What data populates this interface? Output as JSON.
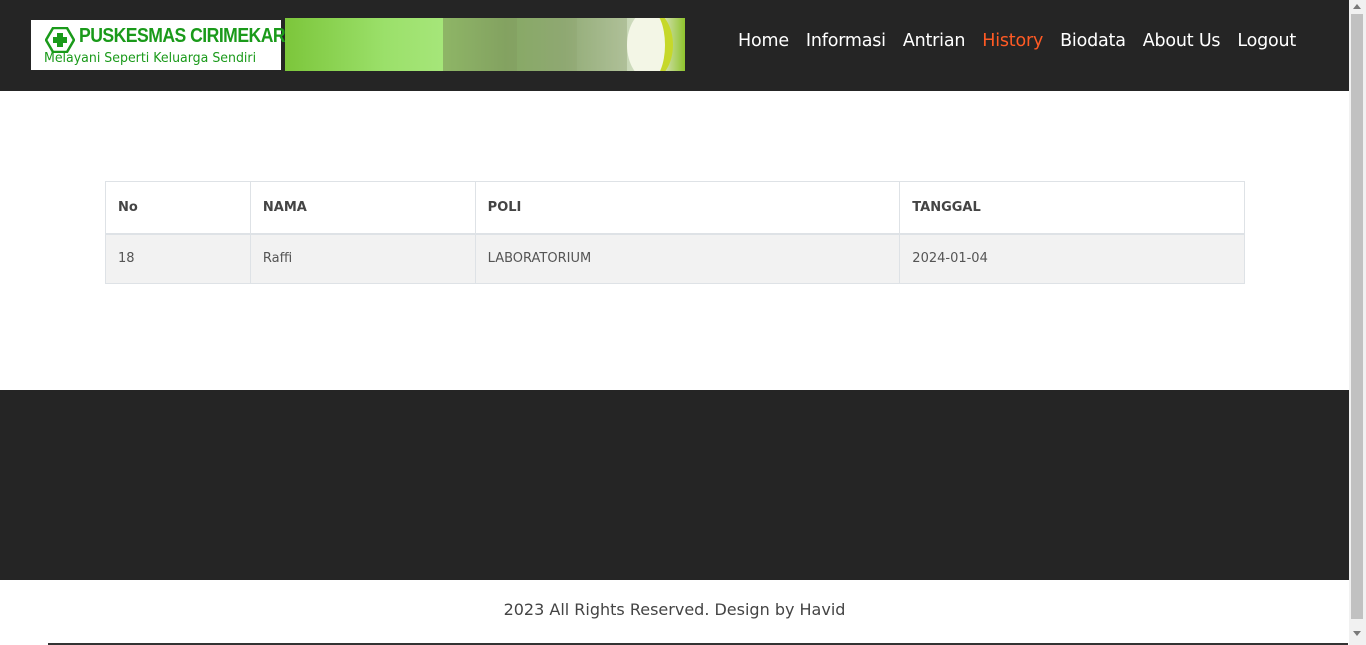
{
  "header": {
    "logo_title": "PUSKESMAS CIRIMEKAR",
    "logo_tagline": "Melayani Seperti Keluarga Sendiri",
    "logo_icon": "medical-cross-icon",
    "brand_color": "#1a9a1a",
    "nav": [
      {
        "label": "Home",
        "active": false
      },
      {
        "label": "Informasi",
        "active": false
      },
      {
        "label": "Antrian",
        "active": false
      },
      {
        "label": "History",
        "active": true
      },
      {
        "label": "Biodata",
        "active": false
      },
      {
        "label": "About Us",
        "active": false
      },
      {
        "label": "Logout",
        "active": false
      }
    ],
    "active_color": "#ff5a24"
  },
  "history_table": {
    "columns": [
      "No",
      "NAMA",
      "POLI",
      "TANGGAL"
    ],
    "rows": [
      {
        "no": "18",
        "nama": "Raffi",
        "poli": "LABORATORIUM",
        "tanggal": "2024-01-04"
      }
    ]
  },
  "footer": {
    "copyright": "2023 All Rights Reserved. Design by Havid"
  }
}
